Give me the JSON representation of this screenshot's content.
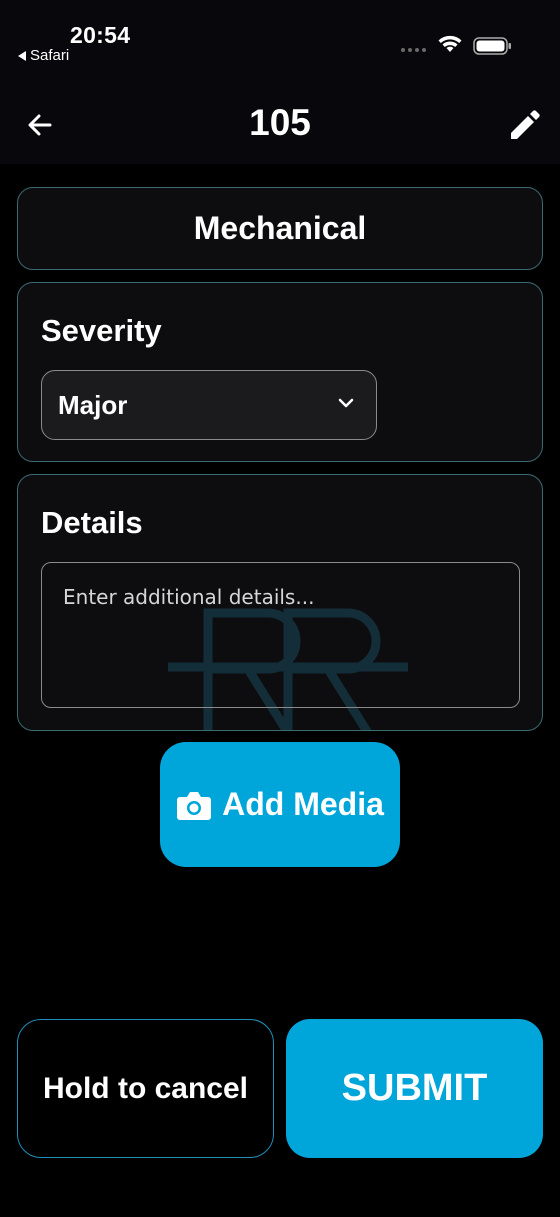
{
  "status_bar": {
    "time": "20:54",
    "back_app": "Safari",
    "wifi_icon": "wifi-icon",
    "battery_icon": "battery-icon"
  },
  "header": {
    "title": "105",
    "back_icon": "back-arrow-icon",
    "edit_icon": "pencil-icon"
  },
  "category": {
    "label": "Mechanical"
  },
  "severity": {
    "label": "Severity",
    "selected": "Major",
    "chevron_icon": "chevron-down-icon"
  },
  "details": {
    "label": "Details",
    "placeholder": "Enter additional details...",
    "value": ""
  },
  "add_media": {
    "label": "Add Media",
    "icon": "camera-icon"
  },
  "actions": {
    "cancel_label": "Hold to cancel",
    "submit_label": "SUBMIT"
  },
  "colors": {
    "accent": "#00a6da",
    "card_border": "#3b6b6f",
    "background": "#000000"
  }
}
